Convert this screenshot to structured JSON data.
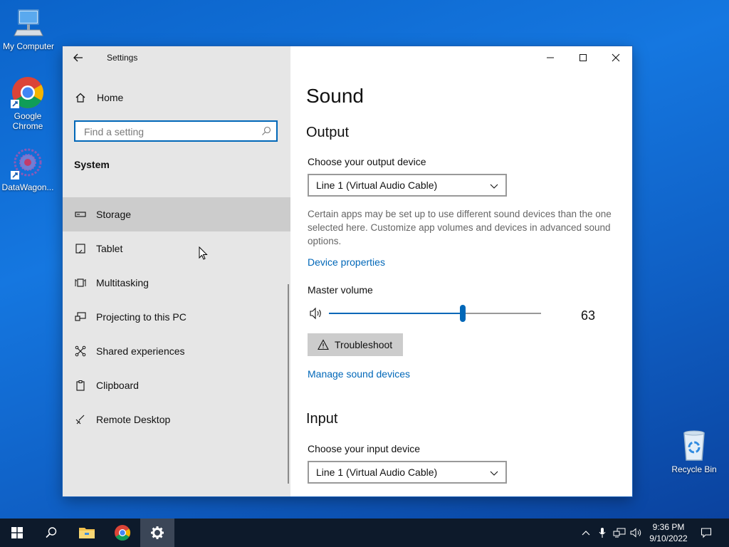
{
  "desktop": {
    "icons": [
      {
        "label": "My Computer"
      },
      {
        "label": "Google Chrome"
      },
      {
        "label": "DataWagon..."
      },
      {
        "label": "Recycle Bin"
      }
    ]
  },
  "window": {
    "title": "Settings",
    "controls": {
      "minimize": "minimize",
      "maximize": "maximize",
      "close": "close"
    }
  },
  "sidebar": {
    "home_label": "Home",
    "search_placeholder": "Find a setting",
    "section_label": "System",
    "items": [
      {
        "label": "Storage",
        "icon": "storage-icon",
        "active": true
      },
      {
        "label": "Tablet",
        "icon": "tablet-icon"
      },
      {
        "label": "Multitasking",
        "icon": "multitasking-icon"
      },
      {
        "label": "Projecting to this PC",
        "icon": "projecting-icon"
      },
      {
        "label": "Shared experiences",
        "icon": "shared-experiences-icon"
      },
      {
        "label": "Clipboard",
        "icon": "clipboard-icon"
      },
      {
        "label": "Remote Desktop",
        "icon": "remote-desktop-icon"
      }
    ]
  },
  "main": {
    "title": "Sound",
    "output": {
      "heading": "Output",
      "device_label": "Choose your output device",
      "device_value": "Line 1 (Virtual Audio Cable)",
      "description": "Certain apps may be set up to use different sound devices than the one selected here. Customize app volumes and devices in advanced sound options.",
      "device_properties_link": "Device properties",
      "master_volume_label": "Master volume",
      "master_volume_value": 63,
      "master_volume_text": "63",
      "troubleshoot_label": "Troubleshoot",
      "manage_link": "Manage sound devices"
    },
    "input": {
      "heading": "Input",
      "device_label": "Choose your input device",
      "device_value": "Line 1 (Virtual Audio Cable)"
    }
  },
  "taskbar": {
    "clock_time": "9:36 PM",
    "clock_date": "9/10/2022"
  },
  "colors": {
    "accent": "#0067b8",
    "sidebar_bg": "#e6e6e6",
    "taskbar_bg": "#0d1a2b"
  }
}
